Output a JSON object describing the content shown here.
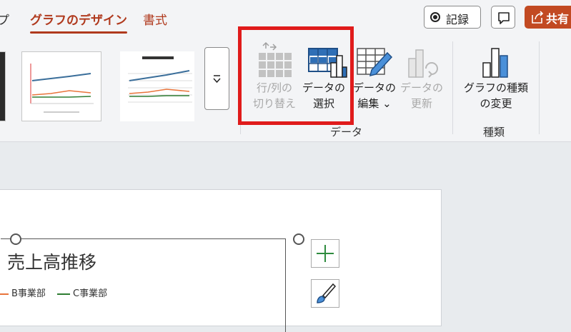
{
  "tabs": {
    "prev_cut": "プ",
    "chart_design": "グラフのデザイン",
    "format": "書式"
  },
  "topbar": {
    "record_label": "記録",
    "share_label": "共有"
  },
  "ribbon": {
    "switch_row_col": "行/列の\n切り替え",
    "select_data": "データの\n選択",
    "edit_data": "データの\n編集 ⌄",
    "refresh_data": "データの\n更新",
    "change_chart_type": "グラフの種類\nの変更",
    "group_data": "データ",
    "group_type": "種類"
  },
  "chart": {
    "title": "売上高推移",
    "legend": [
      {
        "name": "B事業部",
        "color": "#e8743b"
      },
      {
        "name": "C事業部",
        "color": "#2e7d32"
      }
    ]
  },
  "colors": {
    "accent": "#b03a1e",
    "share_bg": "#c24a22",
    "highlight": "#e01b1b",
    "icon_blue": "#2f6fb6"
  }
}
